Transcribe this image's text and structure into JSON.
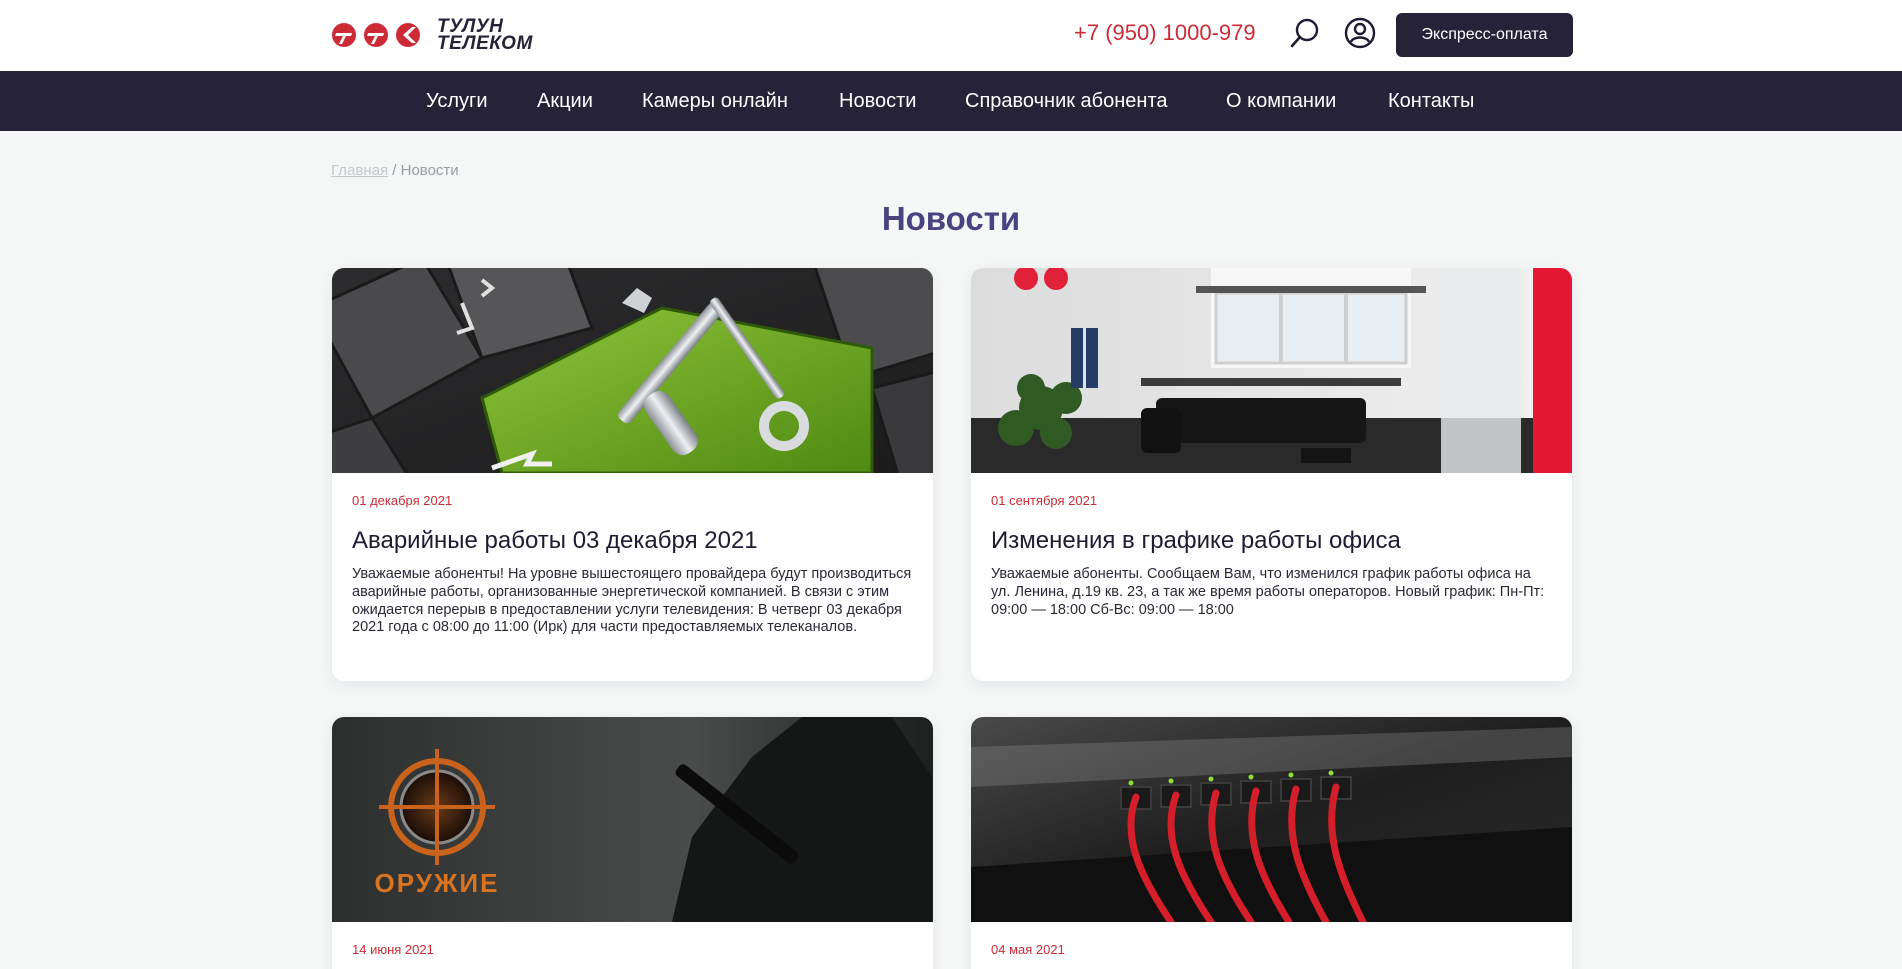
{
  "header": {
    "logo_line1": "ТУЛУН",
    "logo_line2": "ТЕЛЕКОМ",
    "phone": "+7 (950) 1000-979",
    "express_label": "Экспресс-оплата",
    "icons": {
      "search": "search-icon",
      "account": "user-circle-icon"
    },
    "colors": {
      "brand": "#262238",
      "accent": "#cc2b36"
    }
  },
  "nav": {
    "items": [
      {
        "label": "Услуги"
      },
      {
        "label": "Акции"
      },
      {
        "label": "Камеры онлайн"
      },
      {
        "label": "Новости"
      },
      {
        "label": "Справочник абонента"
      },
      {
        "label": "О компании"
      },
      {
        "label": "Контакты"
      }
    ]
  },
  "breadcrumb": {
    "home": "Главная",
    "separator": " / ",
    "current": "Новости"
  },
  "page": {
    "title": "Новости"
  },
  "news": [
    {
      "date": "01 декабря 2021",
      "title": "Аварийные работы 03 декабря 2021",
      "text": "Уважаемые абоненты! На уровне вышестоящего провайдера будут производиться аварийные работы, организованные энергетической компанией. В связи с этим ожидается перерыв в предоставлении услуги телевидения: В четверг 03 декабря 2021 года с 08:00 до 11:00 (Ирк) для части предоставляемых телеканалов."
    },
    {
      "date": "01 сентября 2021",
      "title": "Изменения в графике работы офиса",
      "text": "Уважаемые абоненты. Сообщаем Вам, что изменился график работы офиса на ул. Ленина, д.19 кв. 23, а так же время работы операторов. Новый график: Пн-Пт: 09:00 — 18:00 Сб-Вс: 09:00 — 18:00"
    },
    {
      "date": "14 июня 2021",
      "image_caption": "ОРУЖИЕ"
    },
    {
      "date": "04 мая 2021"
    }
  ]
}
